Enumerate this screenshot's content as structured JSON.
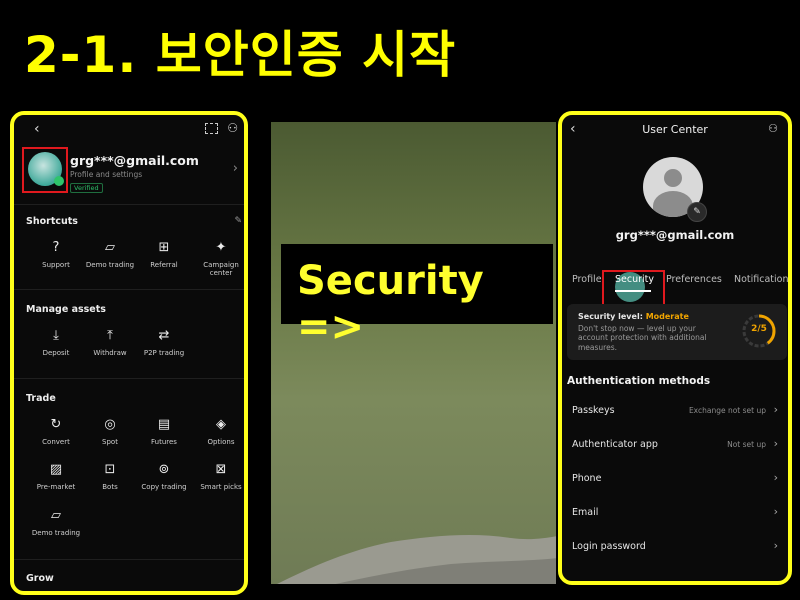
{
  "heading": "2-1. 보안인증 시작",
  "left_phone": {
    "email": "grg***@gmail.com",
    "subtitle": "Profile and settings",
    "badge": "Verified",
    "sections": {
      "shortcuts": "Shortcuts",
      "manage_assets": "Manage assets",
      "trade": "Trade",
      "grow": "Grow"
    },
    "shortcuts": [
      {
        "label": "Support",
        "icon": "question-icon"
      },
      {
        "label": "Demo trading",
        "icon": "demo-icon"
      },
      {
        "label": "Referral",
        "icon": "gift-icon"
      },
      {
        "label": "Campaign center",
        "icon": "party-icon"
      }
    ],
    "manage_assets": [
      {
        "label": "Deposit",
        "icon": "deposit-icon"
      },
      {
        "label": "Withdraw",
        "icon": "withdraw-icon"
      },
      {
        "label": "P2P trading",
        "icon": "p2p-icon"
      }
    ],
    "trade": [
      {
        "label": "Convert",
        "icon": "convert-icon"
      },
      {
        "label": "Spot",
        "icon": "spot-icon"
      },
      {
        "label": "Futures",
        "icon": "futures-icon"
      },
      {
        "label": "Options",
        "icon": "options-icon"
      },
      {
        "label": "Pre-market",
        "icon": "premarket-icon"
      },
      {
        "label": "Bots",
        "icon": "bot-icon"
      },
      {
        "label": "Copy trading",
        "icon": "copy-icon"
      },
      {
        "label": "Smart picks",
        "icon": "smartpicks-icon"
      },
      {
        "label": "Demo trading",
        "icon": "demo-icon"
      }
    ]
  },
  "banner": "Security =>",
  "right_phone": {
    "title": "User Center",
    "email": "grg***@gmail.com",
    "tabs": [
      "Profile",
      "Security",
      "Preferences",
      "Notifications"
    ],
    "active_tab": "Security",
    "security_level_label": "Security level:",
    "security_level_value": "Moderate",
    "security_desc": "Don't stop now — level up your account protection with additional measures.",
    "level_progress": "2/5",
    "level_fraction": 0.4,
    "auth_heading": "Authentication methods",
    "auth_methods": [
      {
        "name": "Passkeys",
        "status": "Exchange not set up"
      },
      {
        "name": "Authenticator app",
        "status": "Not set up"
      },
      {
        "name": "Phone",
        "status": ""
      },
      {
        "name": "Email",
        "status": ""
      },
      {
        "name": "Login password",
        "status": ""
      }
    ]
  },
  "colors": {
    "highlight": "#ffff1a",
    "marker": "#e0191e",
    "accent": "#f0a400"
  }
}
